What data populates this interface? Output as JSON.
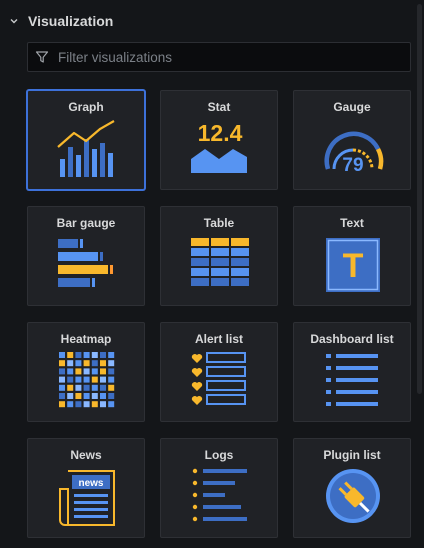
{
  "section": {
    "title": "Visualization",
    "collapsed": false
  },
  "filter": {
    "placeholder": "Filter visualizations",
    "value": ""
  },
  "colors": {
    "blue": "#5794f2",
    "darkblue": "#3d6ec4",
    "yellow": "#f8b82c",
    "orange": "#ff9830",
    "selected_border": "#3d71d9"
  },
  "visualizations": [
    {
      "label": "Graph",
      "icon": "graph-icon",
      "selected": true
    },
    {
      "label": "Stat",
      "icon": "stat-icon",
      "value_text": "12.4"
    },
    {
      "label": "Gauge",
      "icon": "gauge-icon",
      "value_text": "79"
    },
    {
      "label": "Bar gauge",
      "icon": "bar-gauge-icon"
    },
    {
      "label": "Table",
      "icon": "table-icon"
    },
    {
      "label": "Text",
      "icon": "text-icon",
      "glyph": "T"
    },
    {
      "label": "Heatmap",
      "icon": "heatmap-icon"
    },
    {
      "label": "Alert list",
      "icon": "alert-list-icon"
    },
    {
      "label": "Dashboard list",
      "icon": "dashboard-list-icon"
    },
    {
      "label": "News",
      "icon": "news-icon",
      "glyph": "news"
    },
    {
      "label": "Logs",
      "icon": "logs-icon"
    },
    {
      "label": "Plugin list",
      "icon": "plugin-list-icon"
    }
  ]
}
